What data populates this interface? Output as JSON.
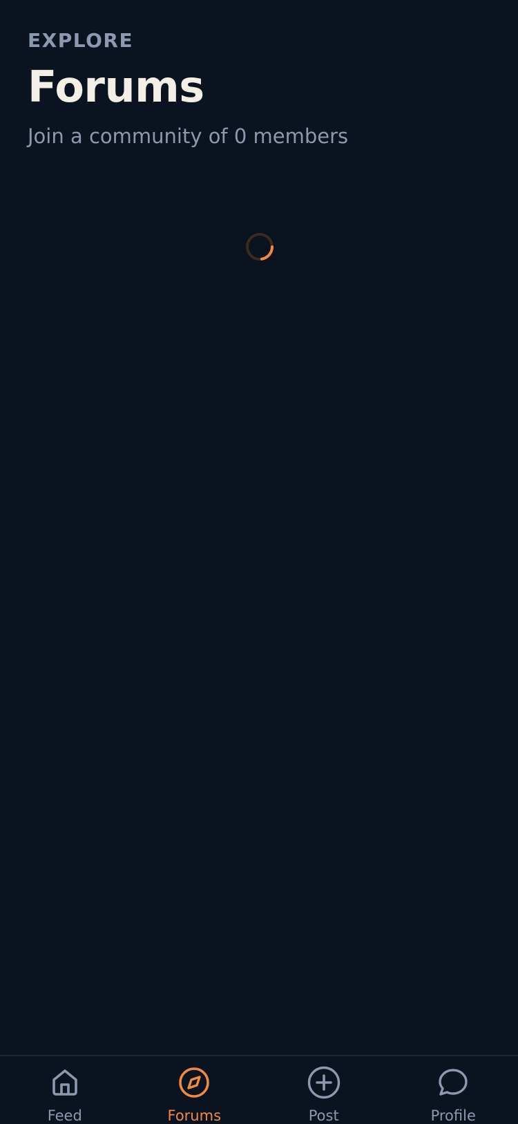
{
  "header": {
    "eyebrow": "EXPLORE",
    "title": "Forums",
    "subtitle": "Join a community of 0 members"
  },
  "loading": {
    "icon": "spinner-icon"
  },
  "tabs": [
    {
      "label": "Feed",
      "icon": "home-icon",
      "active": false
    },
    {
      "label": "Forums",
      "icon": "compass-icon",
      "active": true
    },
    {
      "label": "Post",
      "icon": "plus-circle-icon",
      "active": false
    },
    {
      "label": "Profile",
      "icon": "chat-bubble-icon",
      "active": false
    }
  ],
  "colors": {
    "background": "#0b1220",
    "accent": "#f08a3e",
    "muted": "#8d99ae",
    "title": "#f3eee6"
  }
}
